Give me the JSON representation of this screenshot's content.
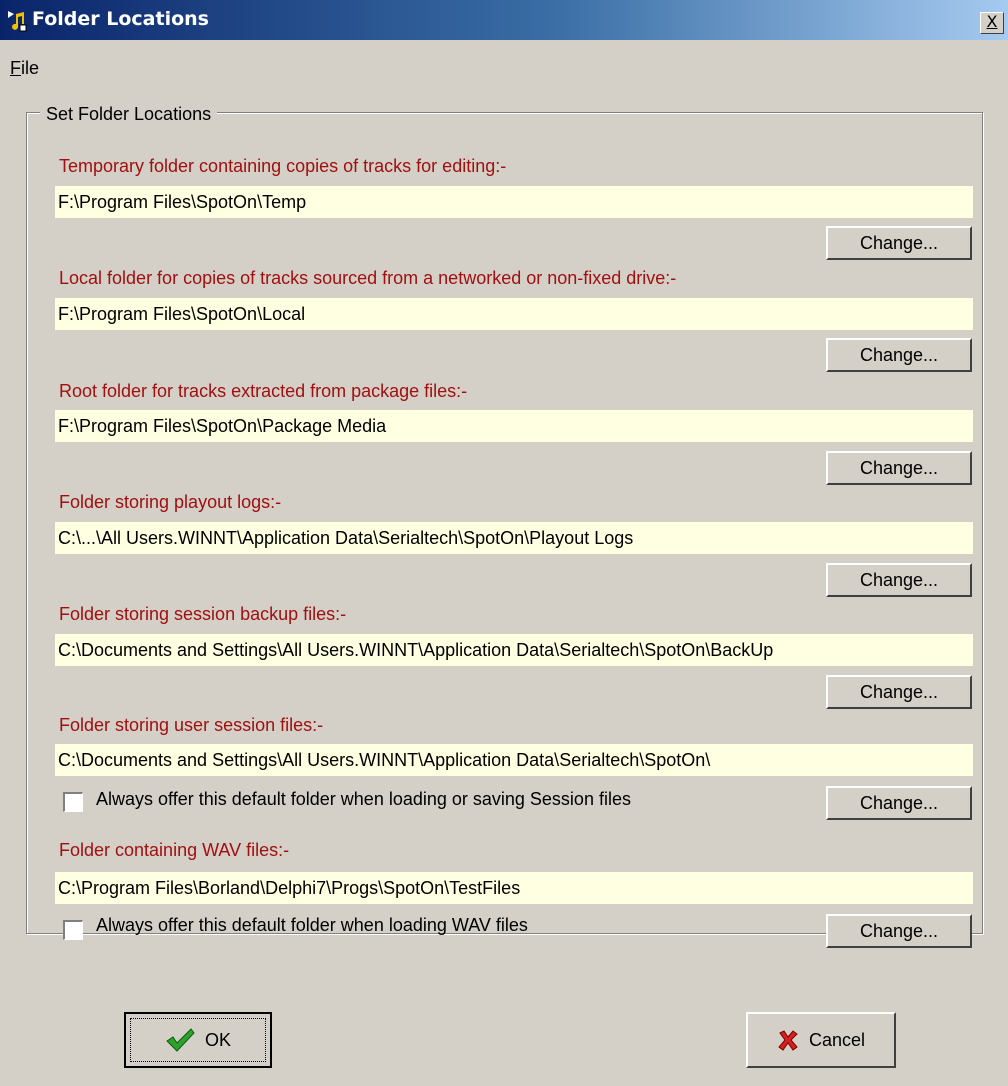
{
  "window": {
    "title": "Folder Locations",
    "close_glyph": "X"
  },
  "menu": {
    "file_ul": "F",
    "file_rest": "ile"
  },
  "group": {
    "legend": "Set Folder Locations"
  },
  "sections": [
    {
      "label": "Temporary folder containing copies of tracks for editing:-",
      "value": "F:\\Program Files\\SpotOn\\Temp",
      "button": "Change..."
    },
    {
      "label": "Local folder for copies of tracks sourced from a networked or non-fixed drive:-",
      "value": "F:\\Program Files\\SpotOn\\Local",
      "button": "Change..."
    },
    {
      "label": "Root folder for tracks extracted from package files:-",
      "value": "F:\\Program Files\\SpotOn\\Package Media",
      "button": "Change..."
    },
    {
      "label": "Folder storing playout logs:-",
      "value": "C:\\...\\All Users.WINNT\\Application Data\\Serialtech\\SpotOn\\Playout Logs",
      "button": "Change..."
    },
    {
      "label": "Folder storing session backup files:-",
      "value": "C:\\Documents and Settings\\All Users.WINNT\\Application Data\\Serialtech\\SpotOn\\BackUp",
      "button": "Change..."
    },
    {
      "label": "Folder storing user session files:-",
      "value": "C:\\Documents and Settings\\All Users.WINNT\\Application Data\\Serialtech\\SpotOn\\",
      "button": "Change...",
      "checkbox": "Always offer this default folder when loading or saving Session files",
      "checked": false
    },
    {
      "label": "Folder containing WAV files:-",
      "value": "C:\\Program Files\\Borland\\Delphi7\\Progs\\SpotOn\\TestFiles",
      "button": "Change...",
      "checkbox": "Always offer this default folder when loading WAV files",
      "checked": false
    }
  ],
  "buttons": {
    "ok": "OK",
    "cancel": "Cancel"
  },
  "colors": {
    "label_red": "#a01010",
    "field_bg": "#ffffe1",
    "face": "#d4d0c8",
    "title_start": "#0a246a"
  }
}
